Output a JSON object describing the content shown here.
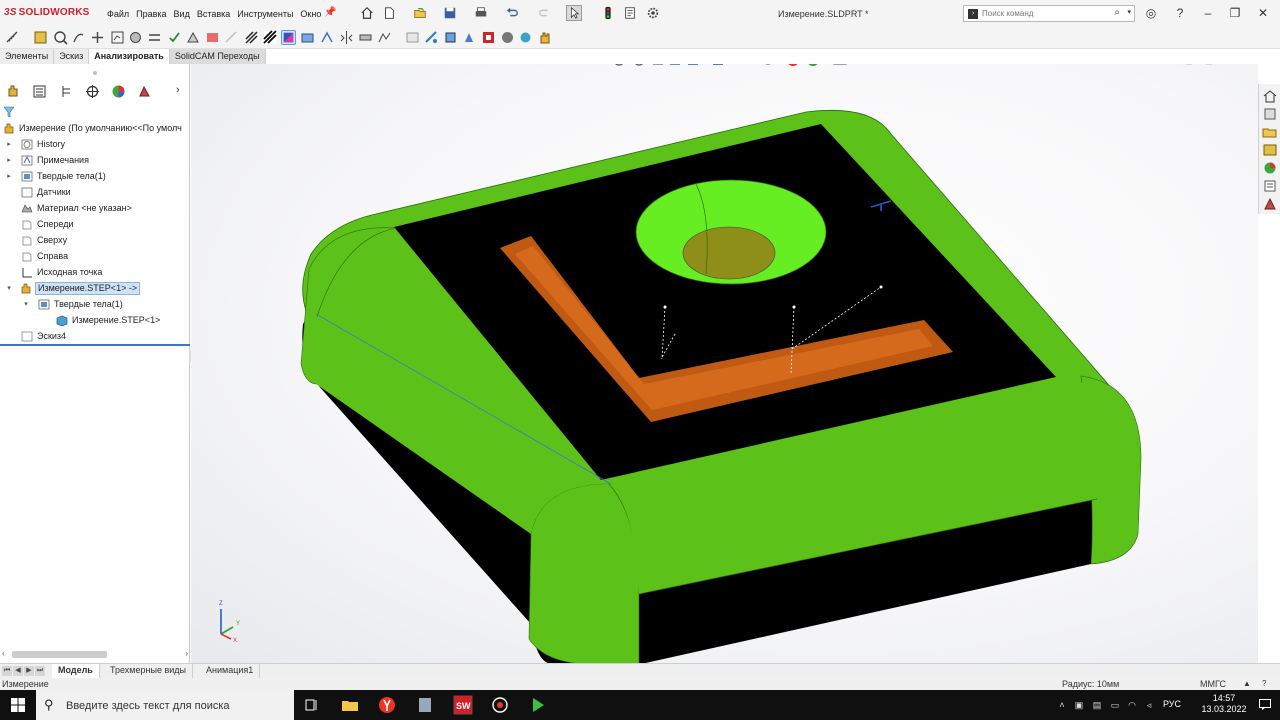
{
  "app": {
    "brand": "SOLIDWORKS",
    "brand_prefix": "3S",
    "document_title": "Измерение.SLDPRT *"
  },
  "menu": [
    "Файл",
    "Правка",
    "Вид",
    "Вставка",
    "Инструменты",
    "Окно"
  ],
  "search": {
    "placeholder": "Поиск команд"
  },
  "tabs": [
    {
      "label": "Элементы",
      "active": false
    },
    {
      "label": "Эскиз",
      "active": false
    },
    {
      "label": "Анализировать",
      "active": true
    },
    {
      "label": "SolidCAM Переходы",
      "active": false
    }
  ],
  "tree": {
    "root_label": "Измерение  (По умолчанию<<По умолч",
    "items": [
      {
        "label": "History"
      },
      {
        "label": "Примечания"
      },
      {
        "label": "Твердые тела(1)"
      },
      {
        "label": "Датчики"
      },
      {
        "label": "Материал <не указан>"
      },
      {
        "label": "Спереди"
      },
      {
        "label": "Сверху"
      },
      {
        "label": "Справа"
      },
      {
        "label": "Исходная точка"
      },
      {
        "label": "Измерение.STEP<1> ->"
      },
      {
        "label": "Твердые тела(1)"
      },
      {
        "label": "Измерение.STEP<1>"
      },
      {
        "label": "Эскиз4"
      }
    ]
  },
  "axes": {
    "x": "X",
    "y": "Y",
    "z": "Z"
  },
  "bottom_tabs": [
    {
      "label": "Модель",
      "active": true
    },
    {
      "label": "Трехмерные виды",
      "active": false
    },
    {
      "label": "Анимация1",
      "active": false
    }
  ],
  "status": {
    "left": "Измерение",
    "radius": "Радиус: 10мм",
    "units": "ММГС"
  },
  "taskbar": {
    "search_placeholder": "Введите здесь текст для поиска",
    "language": "РУС",
    "time": "14:57",
    "date": "13.03.2022"
  },
  "colors": {
    "body_green": "#5cc21a",
    "top_black": "#000000",
    "slot_orange": "#c05a12",
    "hole_green": "#66ee22",
    "hole_floor": "#8d8f18",
    "selection_blue": "#cfe3f7",
    "brand_red": "#d02128"
  }
}
